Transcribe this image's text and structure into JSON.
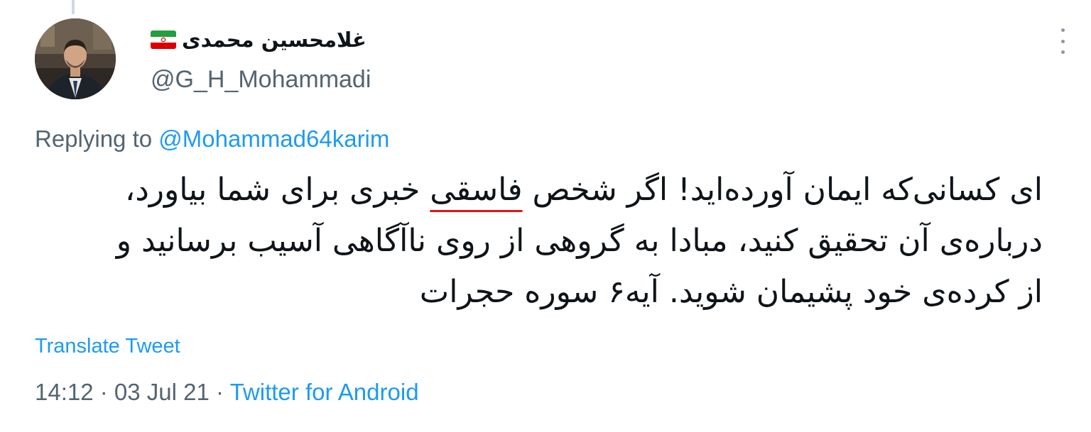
{
  "author": {
    "display_name": "غلامحسین محمدی",
    "handle": "@G_H_Mohammadi",
    "flag_icon": "iran-flag-icon",
    "avatar_icon": "avatar-photo"
  },
  "menu": {
    "more_icon": "more-vertical-icon"
  },
  "reply": {
    "prefix": "Replying to",
    "to_handle": "@Mohammad64karim"
  },
  "tweet": {
    "line1_part1": "ای کسانی‌که ایمان آورده‌اید! اگر شخص ",
    "line1_highlight": "فاسقی",
    "line1_part2": " خبری برای شما بیاورد،",
    "line2": "درباره‌ی آن تحقیق کنید، مبادا به گروهی از روی ناآگاهی آسیب برسانید و",
    "line3": "از کرده‌ی خود پشیمان شوید. آیه۶ سوره حجرات"
  },
  "translate_label": "Translate Tweet",
  "meta": {
    "time": "14:12",
    "separator1": " · ",
    "date": "03 Jul 21",
    "separator2": " · ",
    "source": "Twitter for Android"
  },
  "colors": {
    "link": "#1d9bf0",
    "secondary_text": "#536471",
    "primary_text": "#0f1419",
    "underline_mark": "#e0151b"
  }
}
